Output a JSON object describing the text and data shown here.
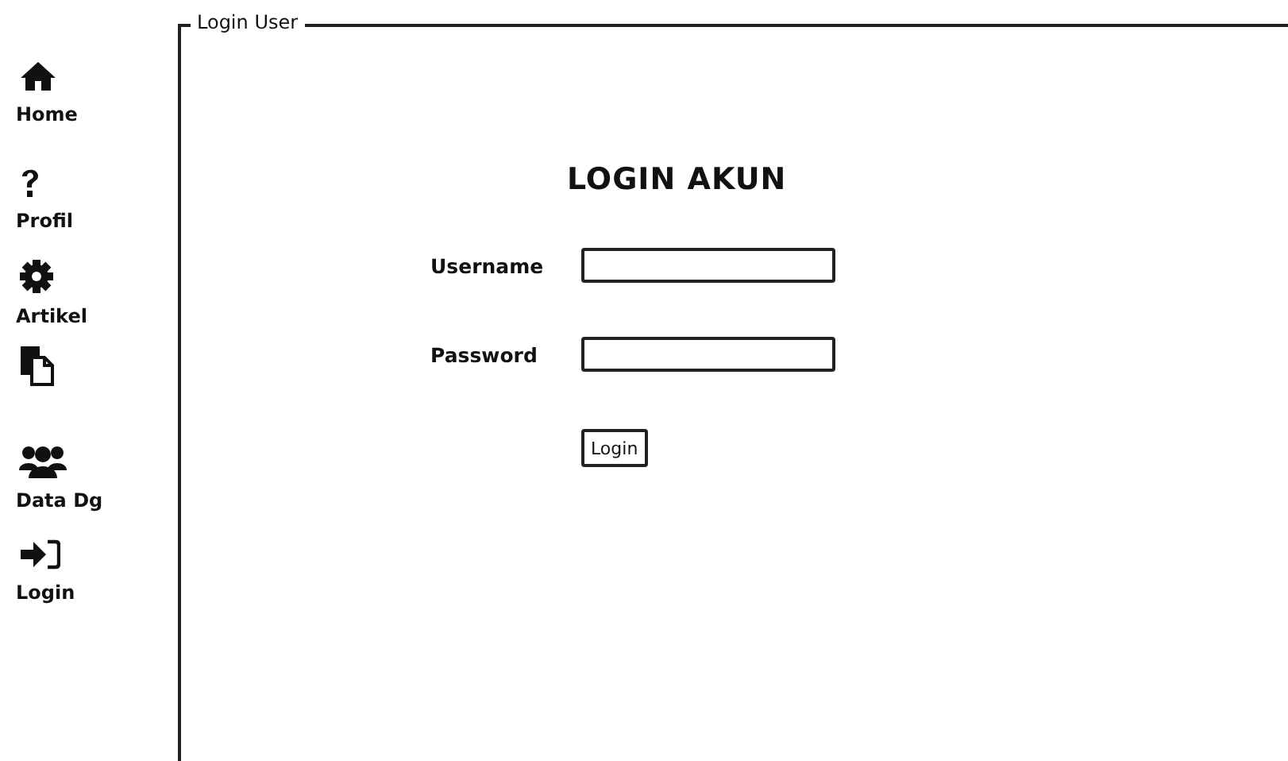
{
  "sidebar": {
    "items": [
      {
        "kind": "labeled",
        "label": "Home"
      },
      {
        "kind": "labeled",
        "label": "Profil"
      },
      {
        "kind": "labeled",
        "label": "Artikel"
      },
      {
        "kind": "icon_only"
      },
      {
        "kind": "labeled",
        "label": "Data Dg"
      },
      {
        "kind": "labeled",
        "label": "Login"
      }
    ]
  },
  "panel": {
    "legend": "Login User",
    "title": "LOGIN AKUN",
    "fields": [
      {
        "label": "Username"
      },
      {
        "label": "Password"
      }
    ],
    "button": "Login"
  }
}
